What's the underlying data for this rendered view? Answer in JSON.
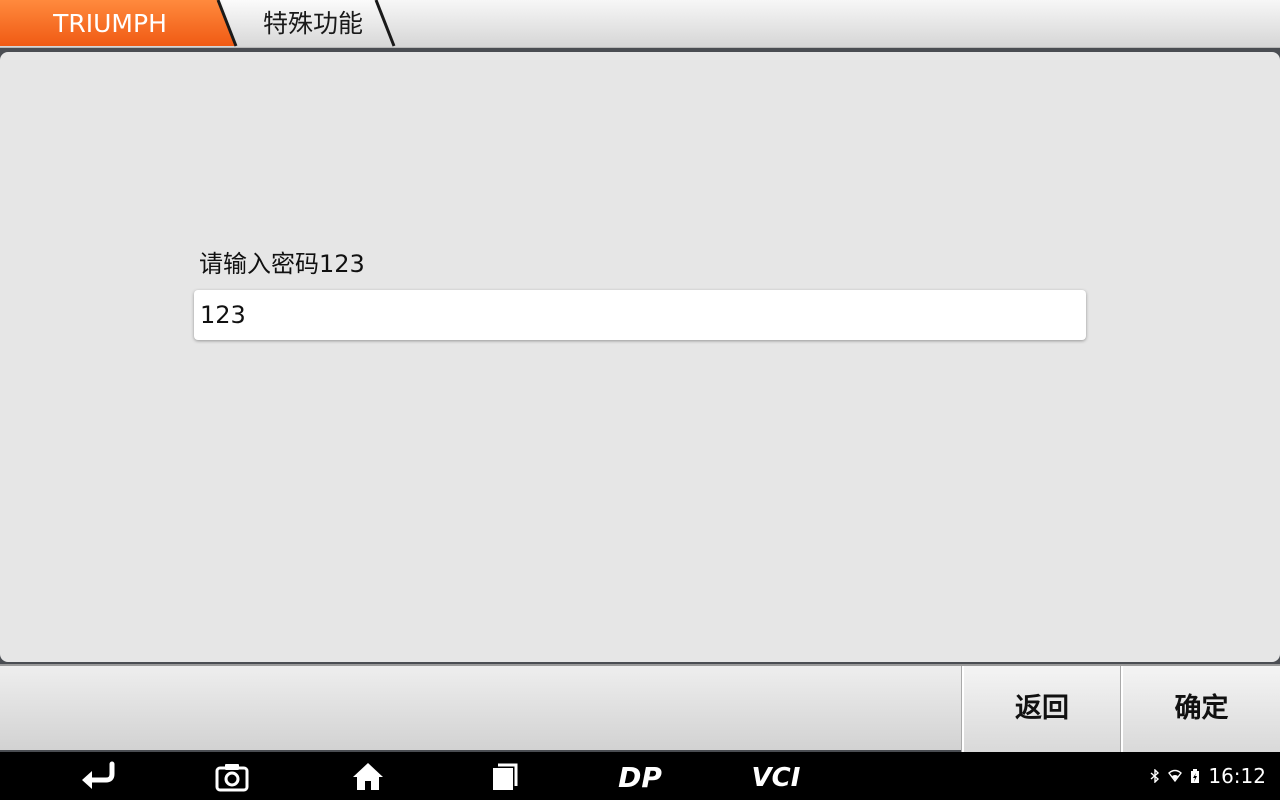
{
  "breadcrumb": {
    "items": [
      {
        "label": "TRIUMPH"
      },
      {
        "label": "特殊功能"
      }
    ]
  },
  "colors": {
    "accent": "#f36b1c",
    "panel": "#e6e6e6",
    "navbar": "#000000"
  },
  "form": {
    "prompt": "请输入密码123",
    "password_value": "123"
  },
  "actions": {
    "back_label": "返回",
    "ok_label": "确定"
  },
  "navbar": {
    "icons": [
      "back-arrow-icon",
      "camera-icon",
      "home-icon",
      "recent-apps-icon",
      "dp-logo-icon",
      "vci-logo-icon"
    ],
    "dp_logo_text": "DP",
    "vci_logo_text": "VCI"
  },
  "status": {
    "icons": [
      "bluetooth-icon",
      "wifi-icon",
      "battery-icon"
    ],
    "time": "16:12"
  }
}
